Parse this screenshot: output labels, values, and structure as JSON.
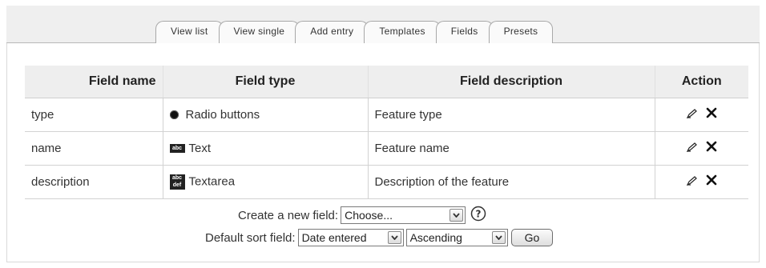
{
  "tabs": [
    {
      "label": "View list"
    },
    {
      "label": "View single"
    },
    {
      "label": "Add entry"
    },
    {
      "label": "Templates"
    },
    {
      "label": "Fields"
    },
    {
      "label": "Presets"
    }
  ],
  "table": {
    "headers": {
      "name": "Field name",
      "type": "Field type",
      "description": "Field description",
      "action": "Action"
    },
    "rows": [
      {
        "name": "type",
        "type_icon": "radio-button-icon",
        "type_label": "Radio buttons",
        "description": "Feature type"
      },
      {
        "name": "name",
        "type_icon": "text-field-icon",
        "type_label": "Text",
        "description": "Feature name"
      },
      {
        "name": "description",
        "type_icon": "textarea-icon",
        "type_label": "Textarea",
        "description": "Description of the feature"
      }
    ],
    "row_actions": [
      "edit-icon",
      "delete-icon"
    ]
  },
  "create_field": {
    "label": "Create a new field:",
    "selected": "Choose..."
  },
  "default_sort": {
    "label": "Default sort field:",
    "field_selected": "Date entered",
    "order_selected": "Ascending",
    "go_label": "Go"
  },
  "colors": {
    "header_bg": "#eeeeee",
    "tabbar_bg": "#efefef",
    "border": "#d2d2d2"
  }
}
